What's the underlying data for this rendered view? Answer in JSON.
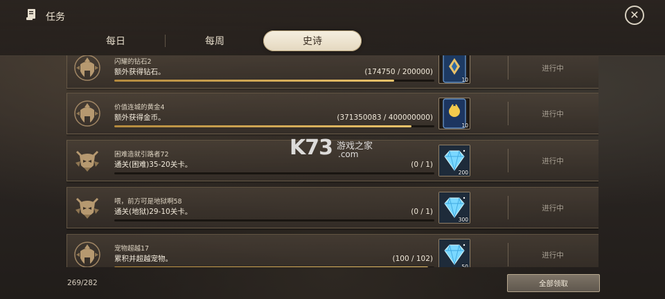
{
  "header": {
    "title": "任务",
    "close_icon": "close-icon",
    "title_icon": "quest-scroll-icon"
  },
  "tabs": [
    {
      "label": "每日",
      "active": false
    },
    {
      "label": "每周",
      "active": false
    },
    {
      "label": "史诗",
      "active": true
    }
  ],
  "quests": [
    {
      "title": "闪耀的钻石2",
      "desc": "额外获得钻石。",
      "progress": "(174750 / 200000)",
      "progress_ratio": 0.874,
      "reward_icon": "gem-card-icon",
      "reward_count": "10",
      "status": "进行中",
      "emblem": "spartan-helmet-icon"
    },
    {
      "title": "价值连城的黄金4",
      "desc": "额外获得金币。",
      "progress": "(371350083 / 400000000)",
      "progress_ratio": 0.928,
      "reward_icon": "gold-card-icon",
      "reward_count": "10",
      "status": "进行中",
      "emblem": "spartan-helmet-icon"
    },
    {
      "title": "困难造就引路者72",
      "desc": "通关(困难)35-20关卡。",
      "progress": "(0 / 1)",
      "progress_ratio": 0,
      "reward_icon": "diamond-icon",
      "reward_count": "200",
      "status": "进行中",
      "emblem": "demon-head-icon"
    },
    {
      "title": "喂，前方可是地狱啊58",
      "desc": "通关(地狱)29-10关卡。",
      "progress": "(0 / 1)",
      "progress_ratio": 0,
      "reward_icon": "diamond-icon",
      "reward_count": "300",
      "status": "进行中",
      "emblem": "demon-head-icon"
    },
    {
      "title": "宠物超越17",
      "desc": "累积并超越宠物。",
      "progress": "(100 / 102)",
      "progress_ratio": 0.98,
      "reward_icon": "diamond-icon",
      "reward_count": "50",
      "status": "进行中",
      "emblem": "spartan-helmet-icon"
    }
  ],
  "footer": {
    "count": "269/282",
    "claim_all_label": "全部领取"
  },
  "watermark": {
    "brand": "K73",
    "site_name": "游戏之家",
    "domain": ".com"
  },
  "colors": {
    "accent_gold": "#e9c26a",
    "active_tab": "#f6efe0",
    "diamond": "#7ad8ff"
  }
}
